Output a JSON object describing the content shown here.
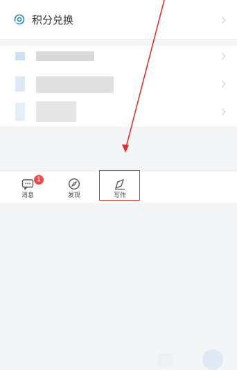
{
  "points_row": {
    "label": "积分兑换",
    "icon": "points-exchange-icon"
  },
  "blurred_items": [
    "item-1",
    "item-2",
    "item-3"
  ],
  "bottom_nav": {
    "tabs": [
      {
        "label": "消息",
        "icon": "message-icon",
        "badge": "1"
      },
      {
        "label": "发现",
        "icon": "compass-icon"
      },
      {
        "label": "写作",
        "icon": "pen-icon"
      }
    ]
  },
  "colors": {
    "accent": "#e0332f",
    "badge": "#f04b4b",
    "icon_blue": "#1f7fd1"
  }
}
